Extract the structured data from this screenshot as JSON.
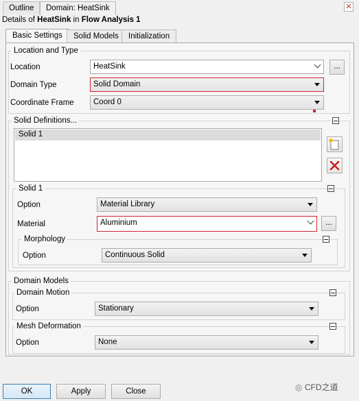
{
  "top_tabs": [
    {
      "label": "Outline"
    },
    {
      "label": "Domain: HeatSink"
    }
  ],
  "details": {
    "prefix": "Details of ",
    "object": "HeatSink",
    "mid": " in ",
    "analysis": "Flow Analysis 1"
  },
  "sub_tabs": [
    {
      "label": "Basic Settings"
    },
    {
      "label": "Solid Models"
    },
    {
      "label": "Initialization"
    }
  ],
  "location_type": {
    "title": "Location and Type",
    "location_label": "Location",
    "location_value": "HeatSink",
    "domain_type_label": "Domain Type",
    "domain_type_value": "Solid Domain",
    "coord_label": "Coordinate Frame",
    "coord_value": "Coord 0"
  },
  "solid_defs": {
    "title": "Solid Definitions...",
    "items": [
      "Solid 1"
    ],
    "solid": {
      "title": "Solid 1",
      "option_label": "Option",
      "option_value": "Material Library",
      "material_label": "Material",
      "material_value": "Aluminium",
      "morph_title": "Morphology",
      "morph_option_label": "Option",
      "morph_option_value": "Continuous Solid"
    }
  },
  "domain_models": {
    "title": "Domain Models",
    "motion_title": "Domain Motion",
    "motion_option_label": "Option",
    "motion_value": "Stationary",
    "mesh_title": "Mesh Deformation",
    "mesh_option_label": "Option",
    "mesh_value": "None"
  },
  "buttons": {
    "ok": "OK",
    "apply": "Apply",
    "close": "Close",
    "dots": "..."
  },
  "watermark": "CFD之道",
  "colors": {
    "highlight_border": "#d1242f",
    "ok_border": "#3c7fb1"
  },
  "icons": [
    "close-icon",
    "dropdown-arrow-icon",
    "new-item-icon",
    "delete-icon",
    "collapse-icon",
    "wechat-icon"
  ]
}
